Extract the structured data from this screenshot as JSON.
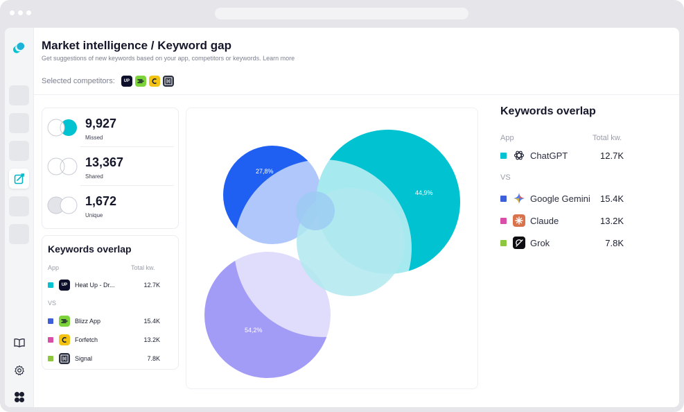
{
  "header": {
    "title": "Market intelligence / Keyword gap",
    "subtitle": "Get suggestions of new keywords based on your app, competitors or keywords. Learn more",
    "competitors_label": "Selected competitors:"
  },
  "competitor_icons": [
    {
      "name": "heat-up",
      "text": "UP",
      "color": "#0d0f2a"
    },
    {
      "name": "blizz",
      "text": "",
      "color": "#7cd33a"
    },
    {
      "name": "forfetch",
      "text": "",
      "color": "#f3c316"
    },
    {
      "name": "signal",
      "text": "",
      "color": "#2a2d3e"
    }
  ],
  "stats": [
    {
      "value": "9,927",
      "label": "Missed"
    },
    {
      "value": "13,367",
      "label": "Shared"
    },
    {
      "value": "1,672",
      "label": "Unique"
    }
  ],
  "left_overlap": {
    "title": "Keywords overlap",
    "col_app": "App",
    "col_total": "Total kw.",
    "vs": "VS",
    "app": {
      "name": "Heat Up - Dr...",
      "total": "12.7K",
      "color": "#00c2d1"
    },
    "competitors": [
      {
        "name": "Blizz App",
        "total": "15.4K",
        "color": "#3d5fd9"
      },
      {
        "name": "Forfetch",
        "total": "13.2K",
        "color": "#d94fa8"
      },
      {
        "name": "Signal",
        "total": "7.8K",
        "color": "#8fc63f"
      }
    ]
  },
  "right_overlap": {
    "title": "Keywords overlap",
    "col_app": "App",
    "col_total": "Total kw.",
    "vs": "VS",
    "app": {
      "name": "ChatGPT",
      "total": "12.7K",
      "color": "#00c2d1"
    },
    "competitors": [
      {
        "name": "Google Gemini",
        "total": "15.4K",
        "color": "#3d5fd9"
      },
      {
        "name": "Claude",
        "total": "13.2K",
        "color": "#d94fa8"
      },
      {
        "name": "Grok",
        "total": "7.8K",
        "color": "#8fc63f"
      }
    ]
  },
  "venn": {
    "labels": [
      "27,8%",
      "44,9%",
      "54,2%"
    ],
    "colors": {
      "blue": "#1f5ff2",
      "teal": "#00c2d1",
      "purple": "#a39cf6"
    }
  }
}
